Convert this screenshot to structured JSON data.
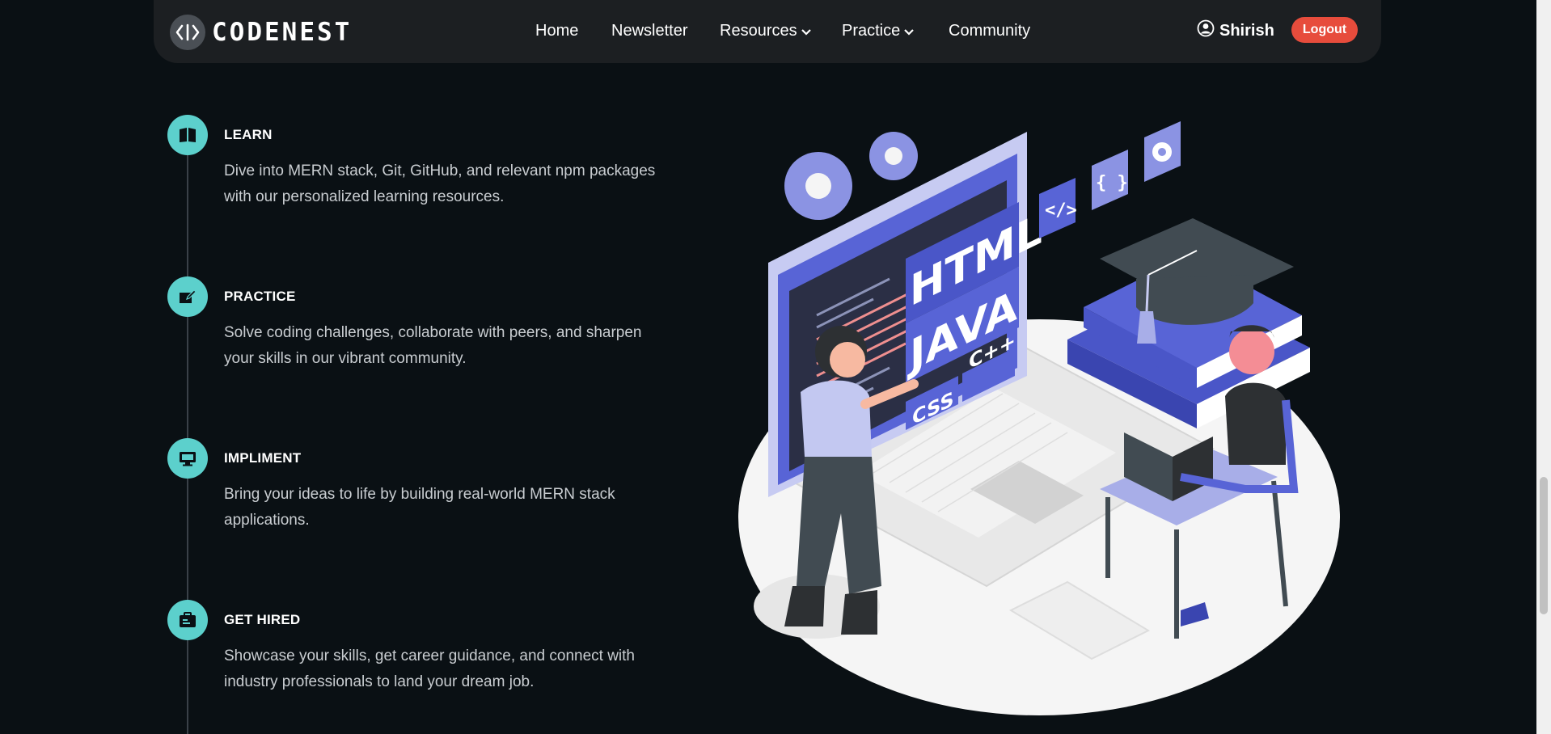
{
  "navbar": {
    "logo_text": "CODENEST",
    "links": [
      {
        "label": "Home",
        "has_dropdown": false
      },
      {
        "label": "Newsletter",
        "has_dropdown": false
      },
      {
        "label": "Resources",
        "has_dropdown": true
      },
      {
        "label": "Practice",
        "has_dropdown": true
      },
      {
        "label": "Community",
        "has_dropdown": false
      }
    ],
    "user_name": "Shirish",
    "logout_label": "Logout"
  },
  "steps": [
    {
      "title": "LEARN",
      "icon": "book-icon",
      "description": "Dive into MERN stack, Git, GitHub, and relevant npm packages with our personalized learning resources."
    },
    {
      "title": "PRACTICE",
      "icon": "edit-icon",
      "description": "Solve coding challenges, collaborate with peers, and sharpen your skills in our vibrant community."
    },
    {
      "title": "IMPLIMENT",
      "icon": "monitor-icon",
      "description": "Bring your ideas to life by building real-world MERN stack applications."
    },
    {
      "title": "GET HIRED",
      "icon": "briefcase-icon",
      "description": "Showcase your skills, get career guidance, and connect with industry professionals to land your dream job."
    }
  ],
  "illustration": {
    "labels": {
      "html": "HTML",
      "java": "JAVA",
      "css": "CSS",
      "cpp": "C++",
      "code_tag": "</>",
      "braces": "{ }"
    }
  },
  "colors": {
    "accent_teal": "#5cd0cc",
    "logout_red": "#e74c3c",
    "illustration_blue": "#5864d6",
    "background": "#0a1014"
  }
}
